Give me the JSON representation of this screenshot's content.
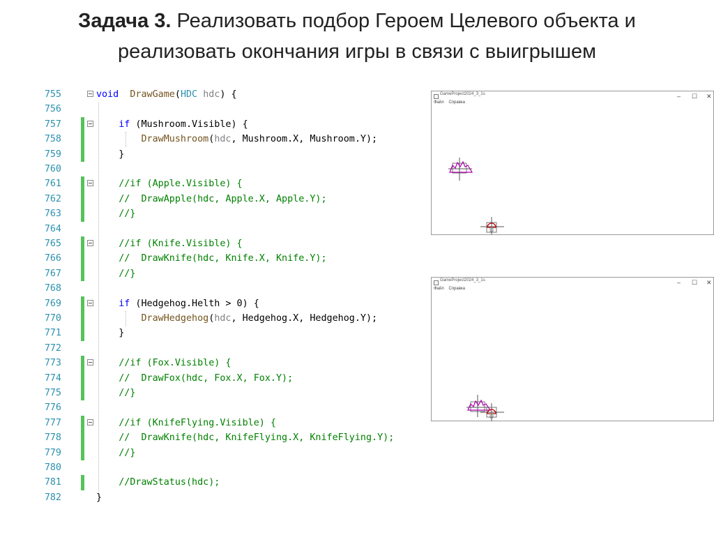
{
  "slide": {
    "title_bold": "Задача 3.",
    "title_line1": " Реализовать подбор Героем Целевого объекта и",
    "title_line2": "реализовать окончания игры в связи с выигрышем"
  },
  "code_lines": [
    {
      "n": "755",
      "bar": false,
      "fold": true,
      "parts": [
        [
          "kw",
          "void"
        ],
        [
          "",
          "  "
        ],
        [
          "fn",
          "DrawGame"
        ],
        [
          "",
          "("
        ],
        [
          "ty",
          "HDC"
        ],
        [
          "",
          " "
        ],
        [
          "prm",
          "hdc"
        ],
        [
          "",
          ") {"
        ]
      ]
    },
    {
      "n": "756",
      "bar": false,
      "fold": false,
      "parts": []
    },
    {
      "n": "757",
      "bar": true,
      "fold": true,
      "parts": [
        [
          "",
          "    "
        ],
        [
          "kw",
          "if"
        ],
        [
          "",
          " (Mushroom.Visible) {"
        ]
      ]
    },
    {
      "n": "758",
      "bar": true,
      "fold": false,
      "parts": [
        [
          "",
          "        "
        ],
        [
          "fn",
          "DrawMushroom"
        ],
        [
          "",
          "("
        ],
        [
          "prm",
          "hdc"
        ],
        [
          "",
          ", Mushroom.X, Mushroom.Y);"
        ]
      ]
    },
    {
      "n": "759",
      "bar": true,
      "fold": false,
      "parts": [
        [
          "",
          "    }"
        ]
      ]
    },
    {
      "n": "760",
      "bar": false,
      "fold": false,
      "parts": []
    },
    {
      "n": "761",
      "bar": true,
      "fold": true,
      "parts": [
        [
          "",
          "    "
        ],
        [
          "cm",
          "//if (Apple.Visible) {"
        ]
      ]
    },
    {
      "n": "762",
      "bar": true,
      "fold": false,
      "parts": [
        [
          "",
          "    "
        ],
        [
          "cm",
          "//  DrawApple(hdc, Apple.X, Apple.Y);"
        ]
      ]
    },
    {
      "n": "763",
      "bar": true,
      "fold": false,
      "parts": [
        [
          "",
          "    "
        ],
        [
          "cm",
          "//}"
        ]
      ]
    },
    {
      "n": "764",
      "bar": false,
      "fold": false,
      "parts": []
    },
    {
      "n": "765",
      "bar": true,
      "fold": true,
      "parts": [
        [
          "",
          "    "
        ],
        [
          "cm",
          "//if (Knife.Visible) {"
        ]
      ]
    },
    {
      "n": "766",
      "bar": true,
      "fold": false,
      "parts": [
        [
          "",
          "    "
        ],
        [
          "cm",
          "//  DrawKnife(hdc, Knife.X, Knife.Y);"
        ]
      ]
    },
    {
      "n": "767",
      "bar": true,
      "fold": false,
      "parts": [
        [
          "",
          "    "
        ],
        [
          "cm",
          "//}"
        ]
      ]
    },
    {
      "n": "768",
      "bar": false,
      "fold": false,
      "parts": []
    },
    {
      "n": "769",
      "bar": true,
      "fold": true,
      "parts": [
        [
          "",
          "    "
        ],
        [
          "kw",
          "if"
        ],
        [
          "",
          " (Hedgehog.Helth > 0) {"
        ]
      ]
    },
    {
      "n": "770",
      "bar": true,
      "fold": false,
      "parts": [
        [
          "",
          "        "
        ],
        [
          "fn",
          "DrawHedgehog"
        ],
        [
          "",
          "("
        ],
        [
          "prm",
          "hdc"
        ],
        [
          "",
          ", Hedgehog.X, Hedgehog.Y);"
        ]
      ]
    },
    {
      "n": "771",
      "bar": true,
      "fold": false,
      "parts": [
        [
          "",
          "    }"
        ]
      ]
    },
    {
      "n": "772",
      "bar": false,
      "fold": false,
      "parts": []
    },
    {
      "n": "773",
      "bar": true,
      "fold": true,
      "parts": [
        [
          "",
          "    "
        ],
        [
          "cm",
          "//if (Fox.Visible) {"
        ]
      ]
    },
    {
      "n": "774",
      "bar": true,
      "fold": false,
      "parts": [
        [
          "",
          "    "
        ],
        [
          "cm",
          "//  DrawFox(hdc, Fox.X, Fox.Y);"
        ]
      ]
    },
    {
      "n": "775",
      "bar": true,
      "fold": false,
      "parts": [
        [
          "",
          "    "
        ],
        [
          "cm",
          "//}"
        ]
      ]
    },
    {
      "n": "776",
      "bar": false,
      "fold": false,
      "parts": []
    },
    {
      "n": "777",
      "bar": true,
      "fold": true,
      "parts": [
        [
          "",
          "    "
        ],
        [
          "cm",
          "//if (KnifeFlying.Visible) {"
        ]
      ]
    },
    {
      "n": "778",
      "bar": true,
      "fold": false,
      "parts": [
        [
          "",
          "    "
        ],
        [
          "cm",
          "//  DrawKnife(hdc, KnifeFlying.X, KnifeFlying.Y);"
        ]
      ]
    },
    {
      "n": "779",
      "bar": true,
      "fold": false,
      "parts": [
        [
          "",
          "    "
        ],
        [
          "cm",
          "//}"
        ]
      ]
    },
    {
      "n": "780",
      "bar": false,
      "fold": false,
      "parts": []
    },
    {
      "n": "781",
      "bar": true,
      "fold": false,
      "parts": [
        [
          "",
          "    "
        ],
        [
          "cm",
          "//DrawStatus(hdc);"
        ]
      ]
    },
    {
      "n": "782",
      "bar": false,
      "fold": false,
      "parts": [
        [
          "",
          "}"
        ]
      ]
    }
  ],
  "app_windows": [
    {
      "caption": "GameProject2024_3_1s",
      "menu": [
        "Файл",
        "Справка"
      ],
      "controls": [
        "–",
        "☐",
        "✕"
      ]
    },
    {
      "caption": "GameProject2024_3_1s",
      "menu": [
        "Файл",
        "Справка"
      ],
      "controls": [
        "–",
        "☐",
        "✕"
      ]
    }
  ],
  "colors": {
    "change_bar": "#57c25a",
    "keyword": "#0000ff",
    "function": "#74531f",
    "type": "#2b91af",
    "comment": "#008000",
    "sprite": "#b000b0"
  }
}
